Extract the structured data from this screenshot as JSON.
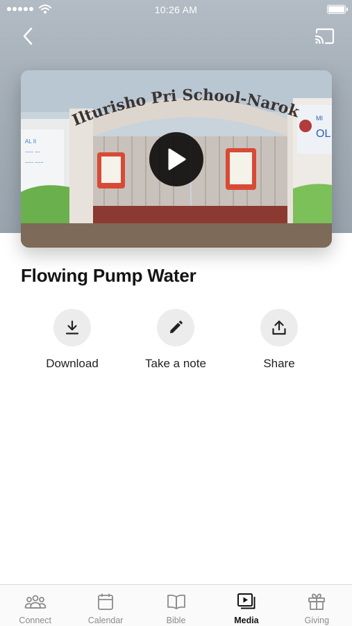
{
  "status_bar": {
    "time": "10:26 AM"
  },
  "nav": {
    "back_icon": "chevron-left-icon",
    "cast_icon": "cast-icon"
  },
  "video": {
    "thumbnail_gate_text": "Ilturisho Pri School-Narok",
    "play_icon": "play-icon"
  },
  "media": {
    "title": "Flowing Pump Water"
  },
  "actions": [
    {
      "label": "Download",
      "icon": "download-icon"
    },
    {
      "label": "Take a note",
      "icon": "pencil-icon"
    },
    {
      "label": "Share",
      "icon": "share-icon"
    }
  ],
  "tabs": [
    {
      "label": "Connect",
      "icon": "people-icon",
      "active": false
    },
    {
      "label": "Calendar",
      "icon": "calendar-icon",
      "active": false
    },
    {
      "label": "Bible",
      "icon": "book-icon",
      "active": false
    },
    {
      "label": "Media",
      "icon": "media-icon",
      "active": true
    },
    {
      "label": "Giving",
      "icon": "gift-icon",
      "active": false
    }
  ],
  "colors": {
    "header": "#a3adb6",
    "accent_active": "#111111",
    "inactive": "#8b8b8b",
    "action_circle": "#ececec"
  }
}
